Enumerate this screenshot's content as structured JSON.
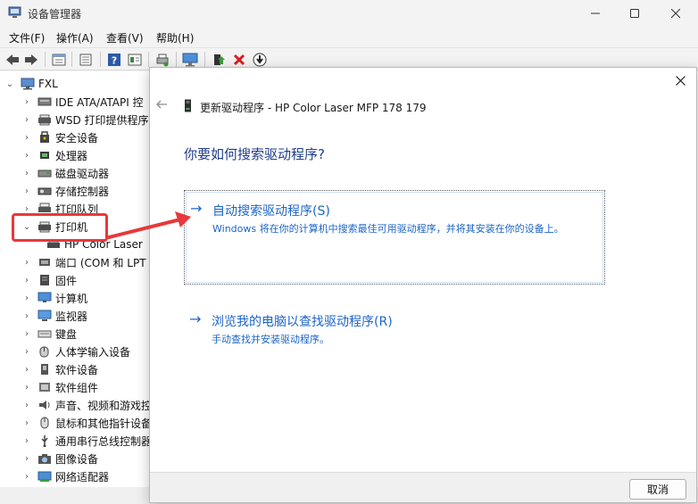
{
  "window": {
    "title": "设备管理器",
    "controls": [
      "minimize-icon",
      "maximize-icon",
      "close-icon"
    ]
  },
  "menu": [
    "文件(F)",
    "操作(A)",
    "查看(V)",
    "帮助(H)"
  ],
  "toolbar": [
    "back-icon",
    "forward-icon",
    "properties-icon",
    "help-icon",
    "view-icon",
    "scan-icon",
    "monitor-icon",
    "update-driver-icon",
    "uninstall-icon",
    "disable-icon"
  ],
  "tree": {
    "root": "FXL",
    "items": [
      {
        "label": "IDE ATA/ATAPI 控",
        "icon": "ide-icon",
        "expanded": false
      },
      {
        "label": "WSD 打印提供程序",
        "icon": "wsd-printer-icon",
        "expanded": false
      },
      {
        "label": "安全设备",
        "icon": "security-device-icon",
        "expanded": false
      },
      {
        "label": "处理器",
        "icon": "processor-icon",
        "expanded": false
      },
      {
        "label": "磁盘驱动器",
        "icon": "disk-drive-icon",
        "expanded": false
      },
      {
        "label": "存储控制器",
        "icon": "storage-controller-icon",
        "expanded": false
      },
      {
        "label": "打印队列",
        "icon": "print-queue-icon",
        "expanded": false
      },
      {
        "label": "打印机",
        "icon": "printer-icon",
        "expanded": true
      },
      {
        "label": "HP Color Laser",
        "icon": "printer-device-icon",
        "child": true
      },
      {
        "label": "端口 (COM 和 LPT",
        "icon": "port-icon",
        "expanded": false
      },
      {
        "label": "固件",
        "icon": "firmware-icon",
        "expanded": false
      },
      {
        "label": "计算机",
        "icon": "computer-icon",
        "expanded": false
      },
      {
        "label": "监视器",
        "icon": "monitor-icon",
        "expanded": false
      },
      {
        "label": "键盘",
        "icon": "keyboard-icon",
        "expanded": false
      },
      {
        "label": "人体学输入设备",
        "icon": "hid-icon",
        "expanded": false
      },
      {
        "label": "软件设备",
        "icon": "software-device-icon",
        "expanded": false
      },
      {
        "label": "软件组件",
        "icon": "software-component-icon",
        "expanded": false
      },
      {
        "label": "声音、视频和游戏控",
        "icon": "audio-icon",
        "expanded": false
      },
      {
        "label": "鼠标和其他指针设备",
        "icon": "mouse-icon",
        "expanded": false
      },
      {
        "label": "通用串行总线控制器",
        "icon": "usb-icon",
        "expanded": false
      },
      {
        "label": "图像设备",
        "icon": "camera-icon",
        "expanded": false
      },
      {
        "label": "网络适配器",
        "icon": "network-adapter-icon",
        "expanded": false
      }
    ]
  },
  "dialog": {
    "header": "更新驱动程序 - HP Color Laser MFP 178 179",
    "question": "你要如何搜索驱动程序?",
    "options": [
      {
        "title": "自动搜索驱动程序(S)",
        "description": "Windows 将在你的计算机中搜索最佳可用驱动程序，并将其安装在你的设备上。"
      },
      {
        "title": "浏览我的电脑以查找驱动程序(R)",
        "description": "手动查找并安装驱动程序。"
      }
    ],
    "cancel": "取消"
  },
  "colors": {
    "link_blue": "#1d65c7",
    "question_blue": "#1f3d8a",
    "annotation_red": "#e8383b"
  }
}
